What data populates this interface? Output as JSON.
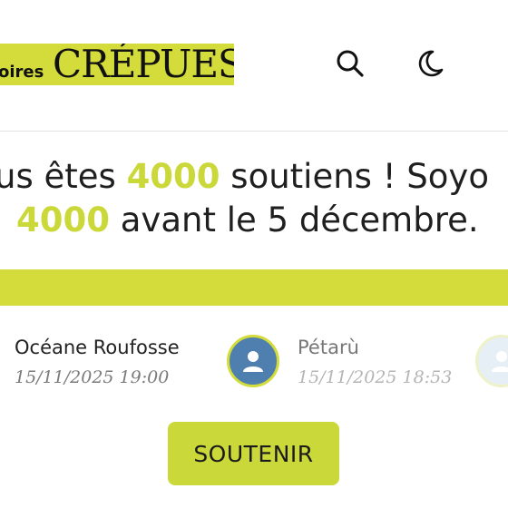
{
  "header": {
    "logo_prefix": "oires",
    "logo_main": "CRÉPUES",
    "search_icon": "search-icon",
    "theme_icon": "moon-icon"
  },
  "headline": {
    "line1_before": "us êtes ",
    "line1_number": "4000",
    "line1_after": " soutiens ! Soyo",
    "line2_number": "4000",
    "line2_after": " avant le 5 décembre."
  },
  "progress": {
    "value_fraction": 1.0,
    "color": "#d3dc3a"
  },
  "supporters": [
    {
      "name": "Océane Roufosse",
      "date": "15/11/2025 19:00"
    },
    {
      "name": "Pétarù",
      "date": "15/11/2025 18:53"
    }
  ],
  "colors": {
    "accent": "#d3dc3a",
    "avatar_bg": "#4f7fae"
  },
  "cta": {
    "label": "SOUTENIR"
  }
}
